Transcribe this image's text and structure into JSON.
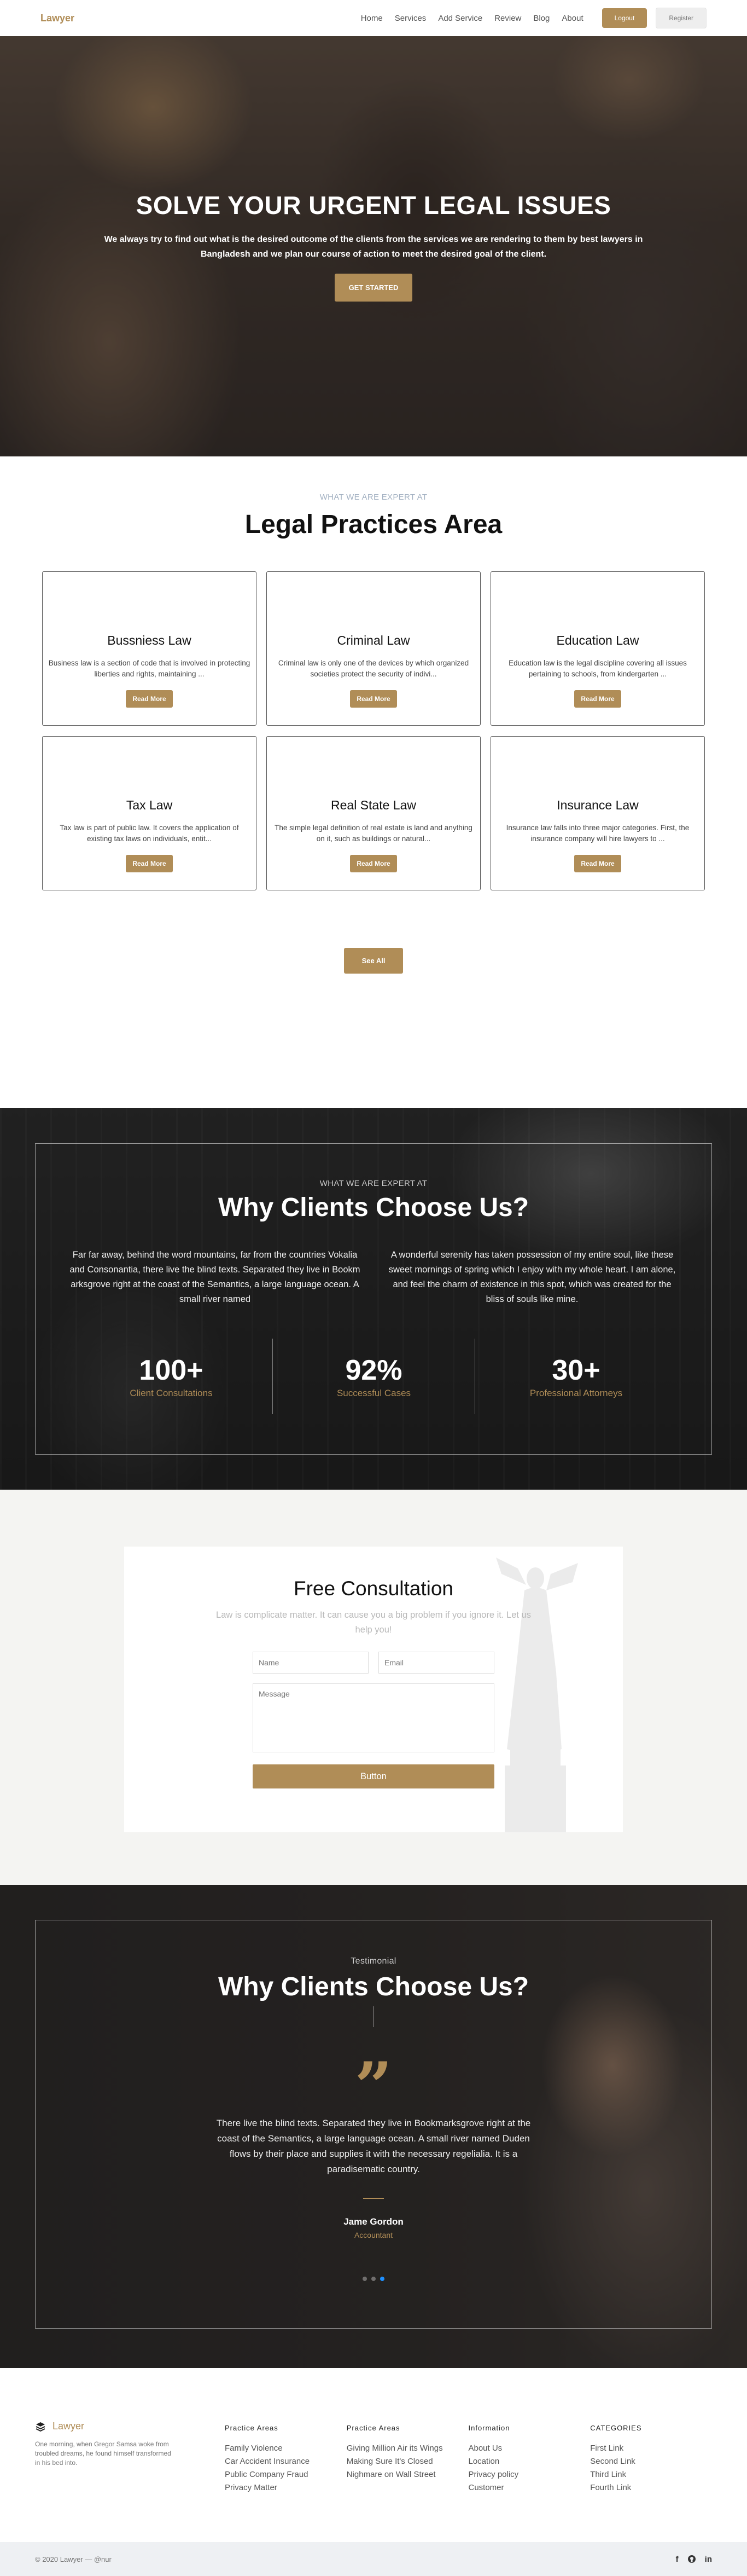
{
  "nav": {
    "brand": "Lawyer",
    "links": [
      "Home",
      "Services",
      "Add Service",
      "Review",
      "Blog",
      "About"
    ],
    "logout": "Logout",
    "register": "Register"
  },
  "hero": {
    "title": "SOLVE YOUR URGENT LEGAL ISSUES",
    "text": "We always try to find out what is the desired outcome of the clients from the services we are rendering to them by best lawyers in Bangladesh and we plan our course of action to meet the desired goal of the client.",
    "cta": "GET STARTED"
  },
  "practices": {
    "eyebrow": "WHAT WE ARE EXPERT AT",
    "title": "Legal Practices Area",
    "read_more": "Read More",
    "see_all": "See All",
    "cards": [
      {
        "title": "Bussniess Law",
        "text": "Business law is a section of code that is involved in protecting liberties and rights, maintaining ..."
      },
      {
        "title": "Criminal Law",
        "text": "Criminal law is only one of the devices by which organized societies protect the security of indivi..."
      },
      {
        "title": "Education Law",
        "text": "Education law is the legal discipline covering all issues pertaining to schools, from kindergarten ..."
      },
      {
        "title": "Tax Law",
        "text": "Tax law is part of public law. It covers the application of existing tax laws on individuals, entit..."
      },
      {
        "title": "Real State Law",
        "text": "The simple legal definition of real estate is land and anything on it, such as buildings or natural..."
      },
      {
        "title": "Insurance Law",
        "text": "Insurance law falls into three major categories. First, the insurance company will hire lawyers to ..."
      }
    ]
  },
  "why": {
    "eyebrow": "WHAT WE ARE EXPERT AT",
    "title": "Why Clients Choose Us?",
    "col1": "Far far away, behind the word mountains, far from the countries Vokalia and Consonantia, there live the blind texts. Separated they live in Bookm arksgrove right at the coast of the Semantics, a large language ocean. A small river named",
    "col2": "A wonderful serenity has taken possession of my entire soul, like these sweet mornings of spring which I enjoy with my whole heart. I am alone, and feel the charm of existence in this spot, which was created for the bliss of souls like mine.",
    "stats": [
      {
        "num": "100+",
        "label": "Client Consultations"
      },
      {
        "num": "92%",
        "label": "Successful Cases"
      },
      {
        "num": "30+",
        "label": "Professional Attorneys"
      }
    ]
  },
  "consult": {
    "title": "Free Consultation",
    "subtitle": "Law is complicate matter. It can cause you a big problem if you ignore it. Let us help you!",
    "name_ph": "Name",
    "email_ph": "Email",
    "message_ph": "Message",
    "button": "Button"
  },
  "testimonial": {
    "eyebrow": "Testimonial",
    "title": "Why Clients Choose Us?",
    "quote_mark": "”",
    "text": "There live the blind texts. Separated they live in Bookmarksgrove right at the coast of the Semantics, a large language ocean. A small river named Duden flows by their place and supplies it with the necessary regelialia. It is a paradisematic country.",
    "name": "Jame Gordon",
    "role": "Accountant"
  },
  "footer": {
    "brand": "Lawyer",
    "about": "One morning, when Gregor Samsa woke from troubled dreams, he found himself transformed in his bed into.",
    "columns": [
      {
        "title": "Practice Areas",
        "items": [
          "Family Violence",
          "Car Accident Insurance",
          "Public Company Fraud",
          "Privacy Matter"
        ]
      },
      {
        "title": "Practice Areas",
        "items": [
          "Giving Million Air its Wings",
          "Making Sure It's Closed",
          "Nighmare on Wall Street"
        ]
      },
      {
        "title": "Information",
        "items": [
          "About Us",
          "Location",
          "Privacy policy",
          "Customer"
        ]
      },
      {
        "title": "CATEGORIES",
        "items": [
          "First Link",
          "Second Link",
          "Third Link",
          "Fourth Link"
        ]
      }
    ],
    "copyright": "© 2020 Lawyer — @nur",
    "socials": [
      "f",
      "in"
    ]
  }
}
